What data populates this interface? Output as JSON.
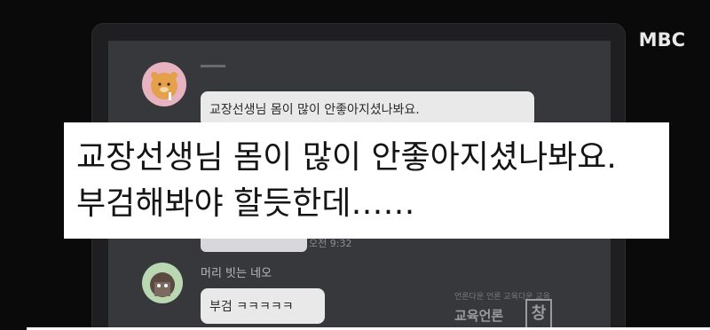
{
  "broadcaster": {
    "logo": "MBC"
  },
  "chat": {
    "message_1": {
      "text": "교장선생님 몸이 많이 안좋아지셨나봐요.",
      "time": "오전 9:32"
    },
    "message_2": {
      "sender": "머리 빗는 네오",
      "text": "부검 ㅋㅋㅋㅋㅋ"
    }
  },
  "caption": {
    "line_1": "교장선생님 몸이 많이 안좋아지셨나봐요.",
    "line_2": "부검해봐야 할듯한데……"
  },
  "watermark": {
    "small": "언론다운 언론 교육다운 교육",
    "big": "교육언론",
    "box": "창"
  },
  "colors": {
    "caption_bg": "#ffffff",
    "screen_bg": "#37383b",
    "bubble_bg": "#e9e9ea"
  }
}
